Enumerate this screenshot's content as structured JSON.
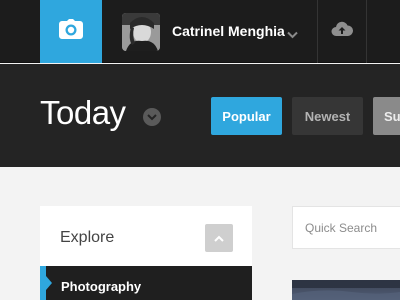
{
  "topbar": {
    "camera_icon": "camera-icon",
    "user": {
      "name": "Catrinel Menghia",
      "menu_icon": "chevron-down-icon"
    },
    "upload_icon": "cloud-upload-icon"
  },
  "header": {
    "title": "Today",
    "title_menu_icon": "chevron-down-icon",
    "tabs": [
      {
        "label": "Popular",
        "active": true
      },
      {
        "label": "Newest",
        "active": false
      },
      {
        "label": "Su",
        "active": false
      }
    ]
  },
  "sidebar": {
    "title": "Explore",
    "collapse_icon": "chevron-up-icon",
    "items": [
      {
        "label": "Photography",
        "active": true
      }
    ]
  },
  "search": {
    "placeholder": "Quick Search",
    "value": ""
  },
  "colors": {
    "accent": "#2fa7de",
    "topbar": "#1c1c1c",
    "header": "#242424",
    "background": "#f3f3f3"
  }
}
